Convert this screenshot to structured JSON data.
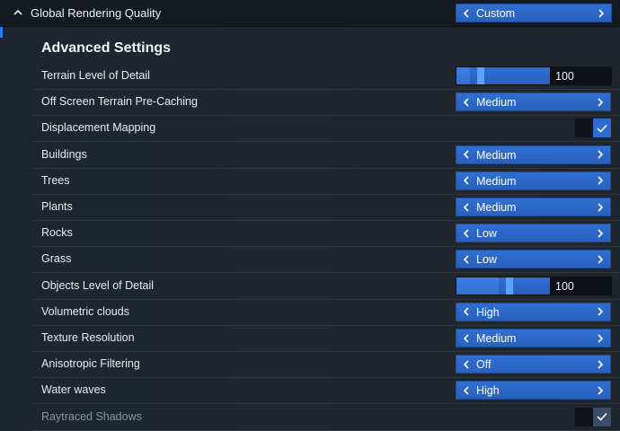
{
  "header": {
    "title": "Global Rendering Quality",
    "value": "Custom"
  },
  "section": {
    "title": "Advanced Settings"
  },
  "settings": [
    {
      "label": "Terrain Level of Detail",
      "type": "slider",
      "value": "100",
      "fill": 0.14
    },
    {
      "label": "Off Screen Terrain Pre-Caching",
      "type": "selector",
      "value": "Medium"
    },
    {
      "label": "Displacement Mapping",
      "type": "checkbox",
      "checked": true
    },
    {
      "label": "Buildings",
      "type": "selector",
      "value": "Medium"
    },
    {
      "label": "Trees",
      "type": "selector",
      "value": "Medium"
    },
    {
      "label": "Plants",
      "type": "selector",
      "value": "Medium"
    },
    {
      "label": "Rocks",
      "type": "selector",
      "value": "Low"
    },
    {
      "label": "Grass",
      "type": "selector",
      "value": "Low"
    },
    {
      "label": "Objects Level of Detail",
      "type": "slider",
      "value": "100",
      "fill": 0.45
    },
    {
      "label": "Volumetric clouds",
      "type": "selector",
      "value": "High"
    },
    {
      "label": "Texture Resolution",
      "type": "selector",
      "value": "Medium"
    },
    {
      "label": "Anisotropic Filtering",
      "type": "selector",
      "value": "Off"
    },
    {
      "label": "Water waves",
      "type": "selector",
      "value": "High"
    },
    {
      "label": "Raytraced Shadows",
      "type": "checkbox",
      "checked": true,
      "disabled": true
    }
  ],
  "colors": {
    "accent": "#2f6fd3",
    "background": "#1f252d"
  },
  "icons": {
    "collapse": "chevron-up-icon",
    "prev": "chevron-left-icon",
    "next": "chevron-right-icon",
    "check": "check-icon"
  }
}
